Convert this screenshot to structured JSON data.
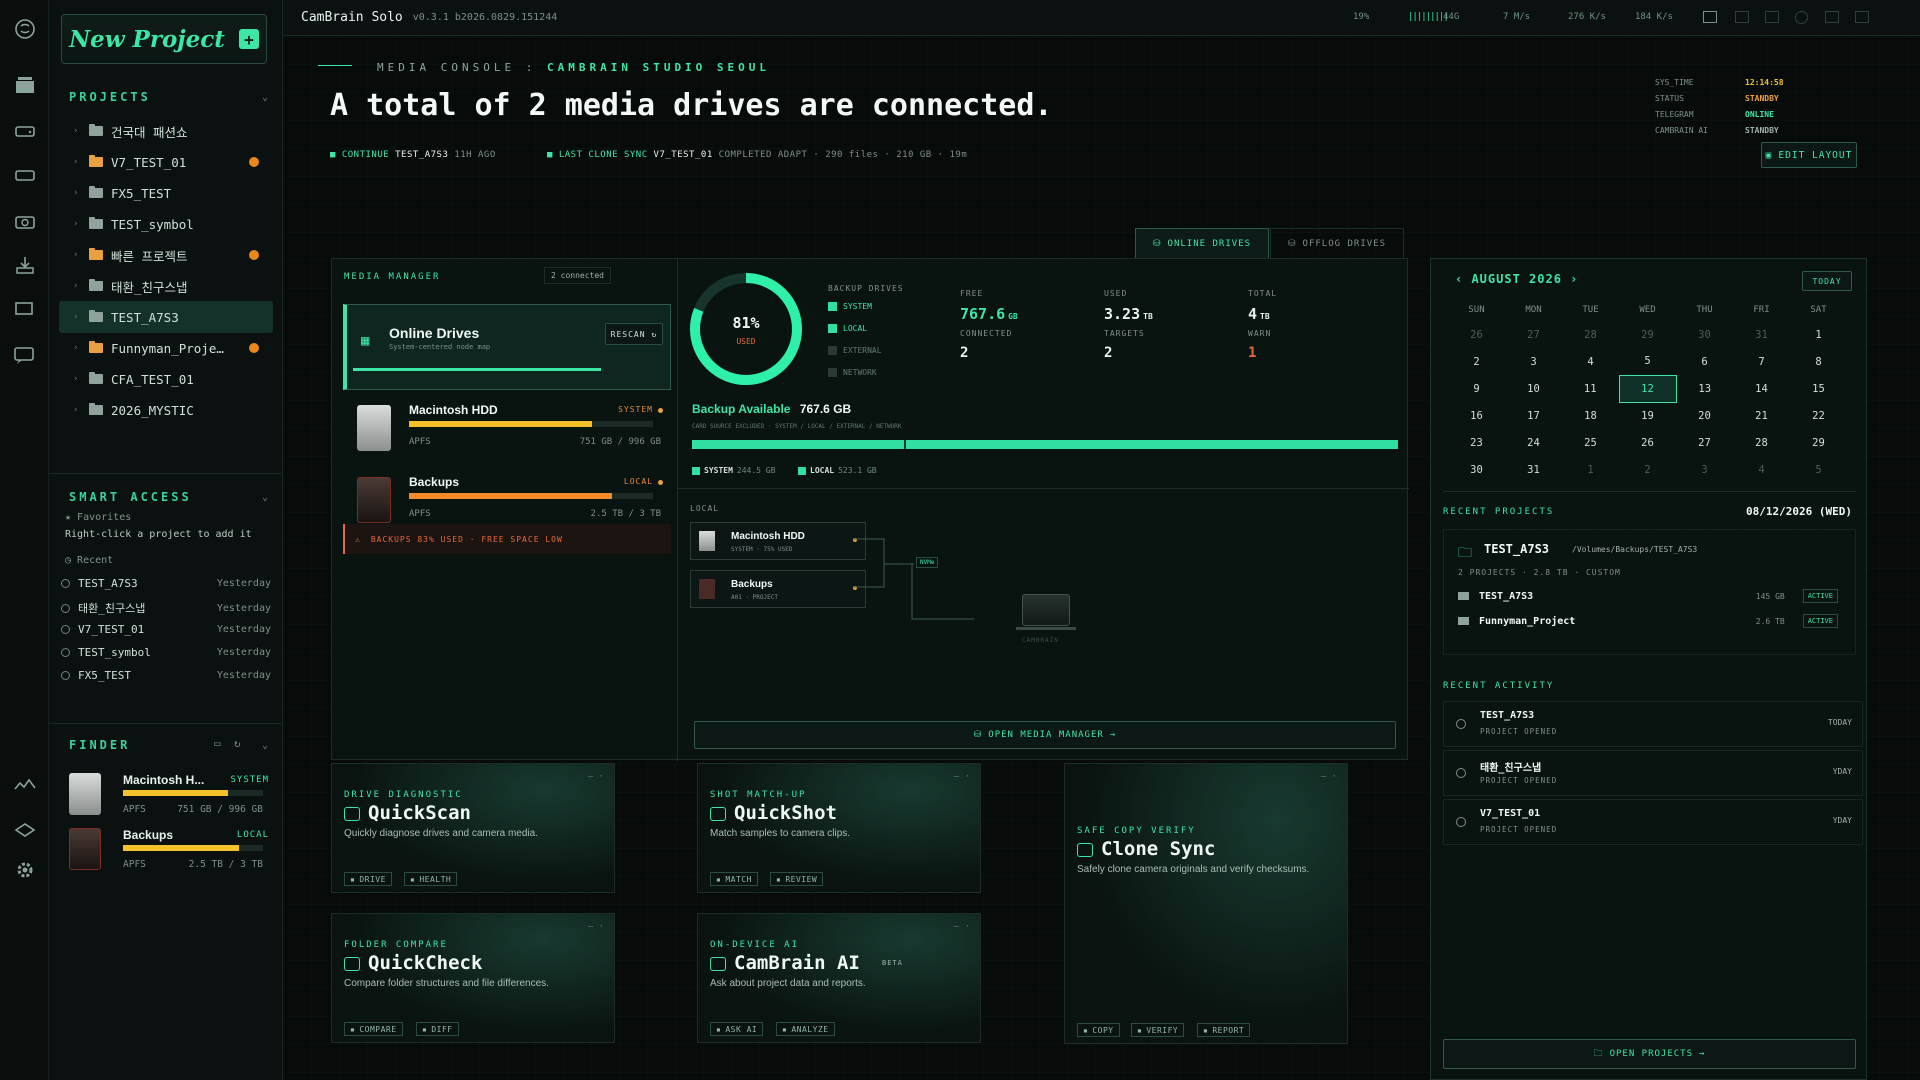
{
  "app": {
    "name": "CamBrain Solo",
    "version": "v0.3.1 b2026.0829.151244"
  },
  "topstats": [
    "19%",
    "44G",
    "7 M/s",
    "276 K/s",
    "184 K/s"
  ],
  "sidebar": {
    "new_project": "New Project",
    "projects_title": "PROJECTS",
    "projects": [
      {
        "label": "건국대 패션쇼",
        "flag": false,
        "orange": false
      },
      {
        "label": "V7_TEST_01",
        "flag": true,
        "orange": true
      },
      {
        "label": "FX5_TEST",
        "flag": false,
        "orange": false
      },
      {
        "label": "TEST_symbol",
        "flag": false,
        "orange": false
      },
      {
        "label": "빠른 프로젝트",
        "flag": true,
        "orange": true
      },
      {
        "label": "태환_친구스냅",
        "flag": false,
        "orange": false
      },
      {
        "label": "TEST_A7S3",
        "flag": false,
        "orange": false,
        "selected": true
      },
      {
        "label": "Funnyman_Proje…",
        "flag": true,
        "orange": true
      },
      {
        "label": "CFA_TEST_01",
        "flag": false,
        "orange": false
      },
      {
        "label": "2026_MYSTIC",
        "flag": false,
        "orange": false
      }
    ],
    "smart_title": "SMART ACCESS",
    "favorites": "Favorites",
    "fav_hint": "Right-click a project to add it",
    "recent_label": "Recent",
    "recent": [
      {
        "name": "TEST_A7S3",
        "when": "Yesterday"
      },
      {
        "name": "태환_친구스냅",
        "when": "Yesterday"
      },
      {
        "name": "V7_TEST_01",
        "when": "Yesterday"
      },
      {
        "name": "TEST_symbol",
        "when": "Yesterday"
      },
      {
        "name": "FX5_TEST",
        "when": "Yesterday"
      }
    ],
    "finder_title": "FINDER",
    "finder": [
      {
        "name": "Macintosh H...",
        "tag": "SYSTEM",
        "fs": "APFS",
        "usage": "751 GB / 996 GB",
        "fill": 0.75
      },
      {
        "name": "Backups",
        "tag": "LOCAL",
        "fs": "APFS",
        "usage": "2.5 TB / 3 TB",
        "fill": 0.83
      }
    ]
  },
  "header": {
    "crumb": "MEDIA CONSOLE : ",
    "crumb_hi": "CAMBRAIN STUDIO SEOUL",
    "title": "A total of 2 media drives are connected.",
    "continue_lbl": "CONTINUE",
    "continue_val": "TEST_A7S3",
    "continue_ago": "11H AGO",
    "sync_lbl": "LAST CLONE SYNC",
    "sync_val": "V7_TEST_01",
    "sync_meta": "COMPLETED ADAPT · 290 files · 210 GB · 19m",
    "sys": [
      {
        "k": "SYS_TIME",
        "v": "12:14:58",
        "c": "#f5c12a"
      },
      {
        "k": "STATUS",
        "v": "STANDBY",
        "c": "#f0a040"
      },
      {
        "k": "TELEGRAM",
        "v": "ONLINE",
        "c": "#3ee6a6"
      },
      {
        "k": "CAMBRAIN AI",
        "v": "STANDBY",
        "c": "#9fb3ab"
      }
    ],
    "edit_layout": "EDIT LAYOUT"
  },
  "tabs": {
    "online": "ONLINE DRIVES",
    "offload": "OFFLOG DRIVES"
  },
  "media": {
    "title": "MEDIA MANAGER",
    "connected": "2 connected",
    "online_title": "Online Drives",
    "online_sub": "System-centered node map",
    "rescan": "RESCAN",
    "drives": [
      {
        "name": "Macintosh HDD",
        "tag": "SYSTEM",
        "fs": "APFS",
        "usage": "751 GB / 996 GB",
        "fill": 0.75
      },
      {
        "name": "Backups",
        "tag": "LOCAL",
        "fs": "APFS",
        "usage": "2.5 TB / 3 TB",
        "fill": 0.83
      }
    ],
    "warning": "BACKUPS 83% USED · FREE SPACE LOW",
    "gauge_pct": "81%",
    "gauge_lbl": "USED",
    "gauge_val": 0.81,
    "backup_drives_lbl": "BACKUP DRIVES",
    "checks": [
      {
        "l": "SYSTEM",
        "on": true
      },
      {
        "l": "LOCAL",
        "on": true
      },
      {
        "l": "EXTERNAL",
        "on": false
      },
      {
        "l": "NETWORK",
        "on": false
      }
    ],
    "stats": [
      {
        "k": "FREE",
        "v": "767.6",
        "u": "GB",
        "c": "#3ee6a6"
      },
      {
        "k": "USED",
        "v": "3.23",
        "u": "TB",
        "c": "#e8f3ef"
      },
      {
        "k": "TOTAL",
        "v": "4",
        "u": "TB",
        "c": "#e8f3ef"
      },
      {
        "k": "CONNECTED",
        "v": "2",
        "u": "",
        "c": "#e8f3ef"
      },
      {
        "k": "TARGETS",
        "v": "2",
        "u": "",
        "c": "#e8f3ef"
      },
      {
        "k": "WARN",
        "v": "1",
        "u": "",
        "c": "#e86a3a"
      }
    ],
    "backup_available_lbl": "Backup Available",
    "backup_available": "767.6 GB",
    "backup_note": "CARD SOURCE EXCLUDED · SYSTEM / LOCAL / EXTERNAL / NETWORK",
    "legend": [
      {
        "l": "SYSTEM",
        "v": "244.5 GB"
      },
      {
        "l": "LOCAL",
        "v": "523.1 GB"
      }
    ],
    "local_lbl": "LOCAL",
    "nodes": [
      {
        "name": "Macintosh HDD",
        "sub": "SYSTEM · 75% USED"
      },
      {
        "name": "Backups",
        "sub": "A01 · PROJECT"
      }
    ],
    "nvme": "NVMe",
    "cam": "CAMBRAIN",
    "open_btn": "OPEN MEDIA MANAGER"
  },
  "calendar": {
    "month": "AUGUST 2026",
    "today": "TODAY",
    "days": [
      "SUN",
      "MON",
      "TUE",
      "WED",
      "THU",
      "FRI",
      "SAT"
    ],
    "weeks": [
      [
        "26",
        "27",
        "28",
        "29",
        "30",
        "31",
        "1"
      ],
      [
        "2",
        "3",
        "4",
        "5",
        "6",
        "7",
        "8"
      ],
      [
        "9",
        "10",
        "11",
        "12",
        "13",
        "14",
        "15"
      ],
      [
        "16",
        "17",
        "18",
        "19",
        "20",
        "21",
        "22"
      ],
      [
        "23",
        "24",
        "25",
        "26",
        "27",
        "28",
        "29"
      ],
      [
        "30",
        "31",
        "1",
        "2",
        "3",
        "4",
        "5"
      ]
    ],
    "selected": "12"
  },
  "recent_projects": {
    "title": "RECENT PROJECTS",
    "date": "08/12/2026 (WED)",
    "folder": "TEST_A7S3",
    "path": "/Volumes/Backups/TEST_A7S3",
    "meta": "2 PROJECTS · 2.8 TB · CUSTOM",
    "items": [
      {
        "name": "TEST_A7S3",
        "size": "145 GB",
        "state": "ACTIVE"
      },
      {
        "name": "Funnyman_Project",
        "size": "2.6 TB",
        "state": "ACTIVE"
      }
    ]
  },
  "activity": {
    "title": "RECENT ACTIVITY",
    "items": [
      {
        "name": "TEST_A7S3",
        "sub": "PROJECT OPENED",
        "when": "TODAY"
      },
      {
        "name": "태환_친구스냅",
        "sub": "PROJECT OPENED",
        "when": "YDAY"
      },
      {
        "name": "V7_TEST_01",
        "sub": "PROJECT OPENED",
        "when": "YDAY"
      }
    ],
    "open_btn": "OPEN PROJECTS"
  },
  "tools": [
    {
      "kicker": "DRIVE DIAGNOSTIC",
      "title": "QuickScan",
      "desc": "Quickly diagnose drives and camera media.",
      "chips": [
        "DRIVE",
        "HEALTH"
      ]
    },
    {
      "kicker": "SHOT MATCH-UP",
      "title": "QuickShot",
      "desc": "Match samples to camera clips.",
      "chips": [
        "MATCH",
        "REVIEW"
      ]
    },
    {
      "kicker": "SAFE COPY VERIFY",
      "title": "Clone Sync",
      "desc": "Safely clone camera originals and verify checksums.",
      "chips": [
        "COPY",
        "VERIFY",
        "REPORT"
      ]
    },
    {
      "kicker": "FOLDER COMPARE",
      "title": "QuickCheck",
      "desc": "Compare folder structures and file differences.",
      "chips": [
        "COMPARE",
        "DIFF"
      ]
    },
    {
      "kicker": "ON-DEVICE AI",
      "title": "CamBrain AI",
      "desc": "Ask about project data and reports.",
      "chips": [
        "ASK AI",
        "ANALYZE"
      ],
      "badge": "BETA"
    }
  ]
}
